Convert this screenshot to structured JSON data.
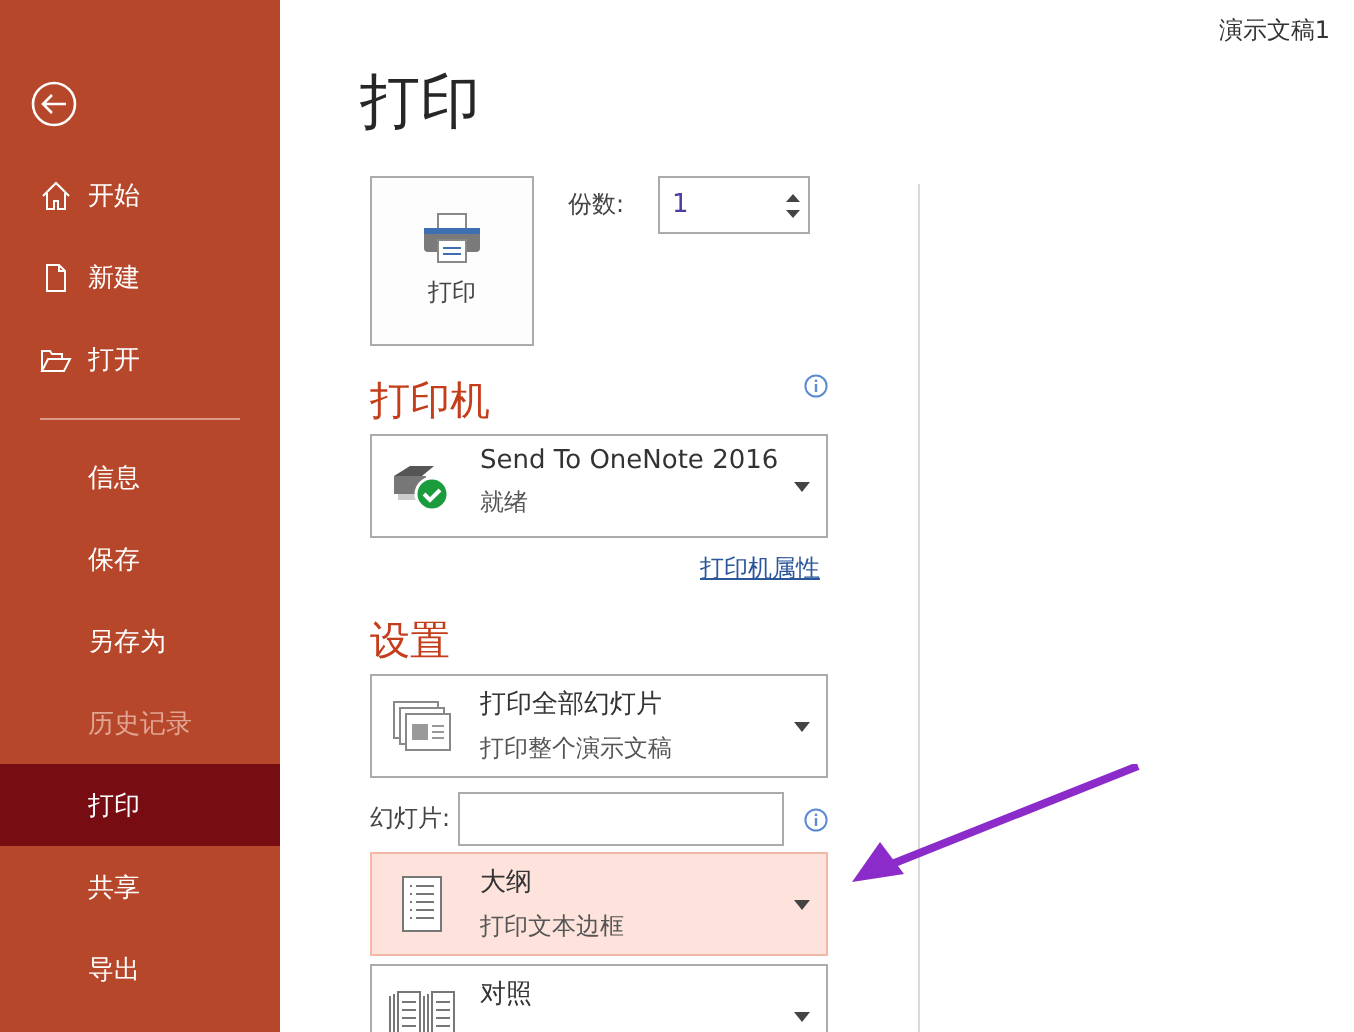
{
  "window": {
    "title": "演示文稿1"
  },
  "sidebar": {
    "items_top": [
      {
        "label": "开始",
        "kind": "home",
        "selected": false,
        "disabled": false
      },
      {
        "label": "新建",
        "kind": "new",
        "selected": false,
        "disabled": false
      },
      {
        "label": "打开",
        "kind": "open",
        "selected": false,
        "disabled": false
      }
    ],
    "items_bottom": [
      {
        "label": "信息",
        "selected": false,
        "disabled": false
      },
      {
        "label": "保存",
        "selected": false,
        "disabled": false
      },
      {
        "label": "另存为",
        "selected": false,
        "disabled": false
      },
      {
        "label": "历史记录",
        "selected": false,
        "disabled": true
      },
      {
        "label": "打印",
        "selected": true,
        "disabled": false
      },
      {
        "label": "共享",
        "selected": false,
        "disabled": false
      },
      {
        "label": "导出",
        "selected": false,
        "disabled": false
      }
    ]
  },
  "page_title": "打印",
  "print_button": {
    "label": "打印"
  },
  "copies": {
    "label": "份数:",
    "value": "1"
  },
  "printer": {
    "heading": "打印机",
    "name": "Send To OneNote 2016",
    "status": "就绪",
    "properties_link": "打印机属性"
  },
  "settings": {
    "heading": "设置",
    "slides_label": "幻灯片:",
    "dropdowns": [
      {
        "kind": "range",
        "title": "打印全部幻灯片",
        "subtitle": "打印整个演示文稿",
        "highlighted": false
      },
      {
        "kind": "layout",
        "title": "大纲",
        "subtitle": "打印文本边框",
        "highlighted": true
      },
      {
        "kind": "collate",
        "title": "对照",
        "highlighted": false
      }
    ]
  }
}
